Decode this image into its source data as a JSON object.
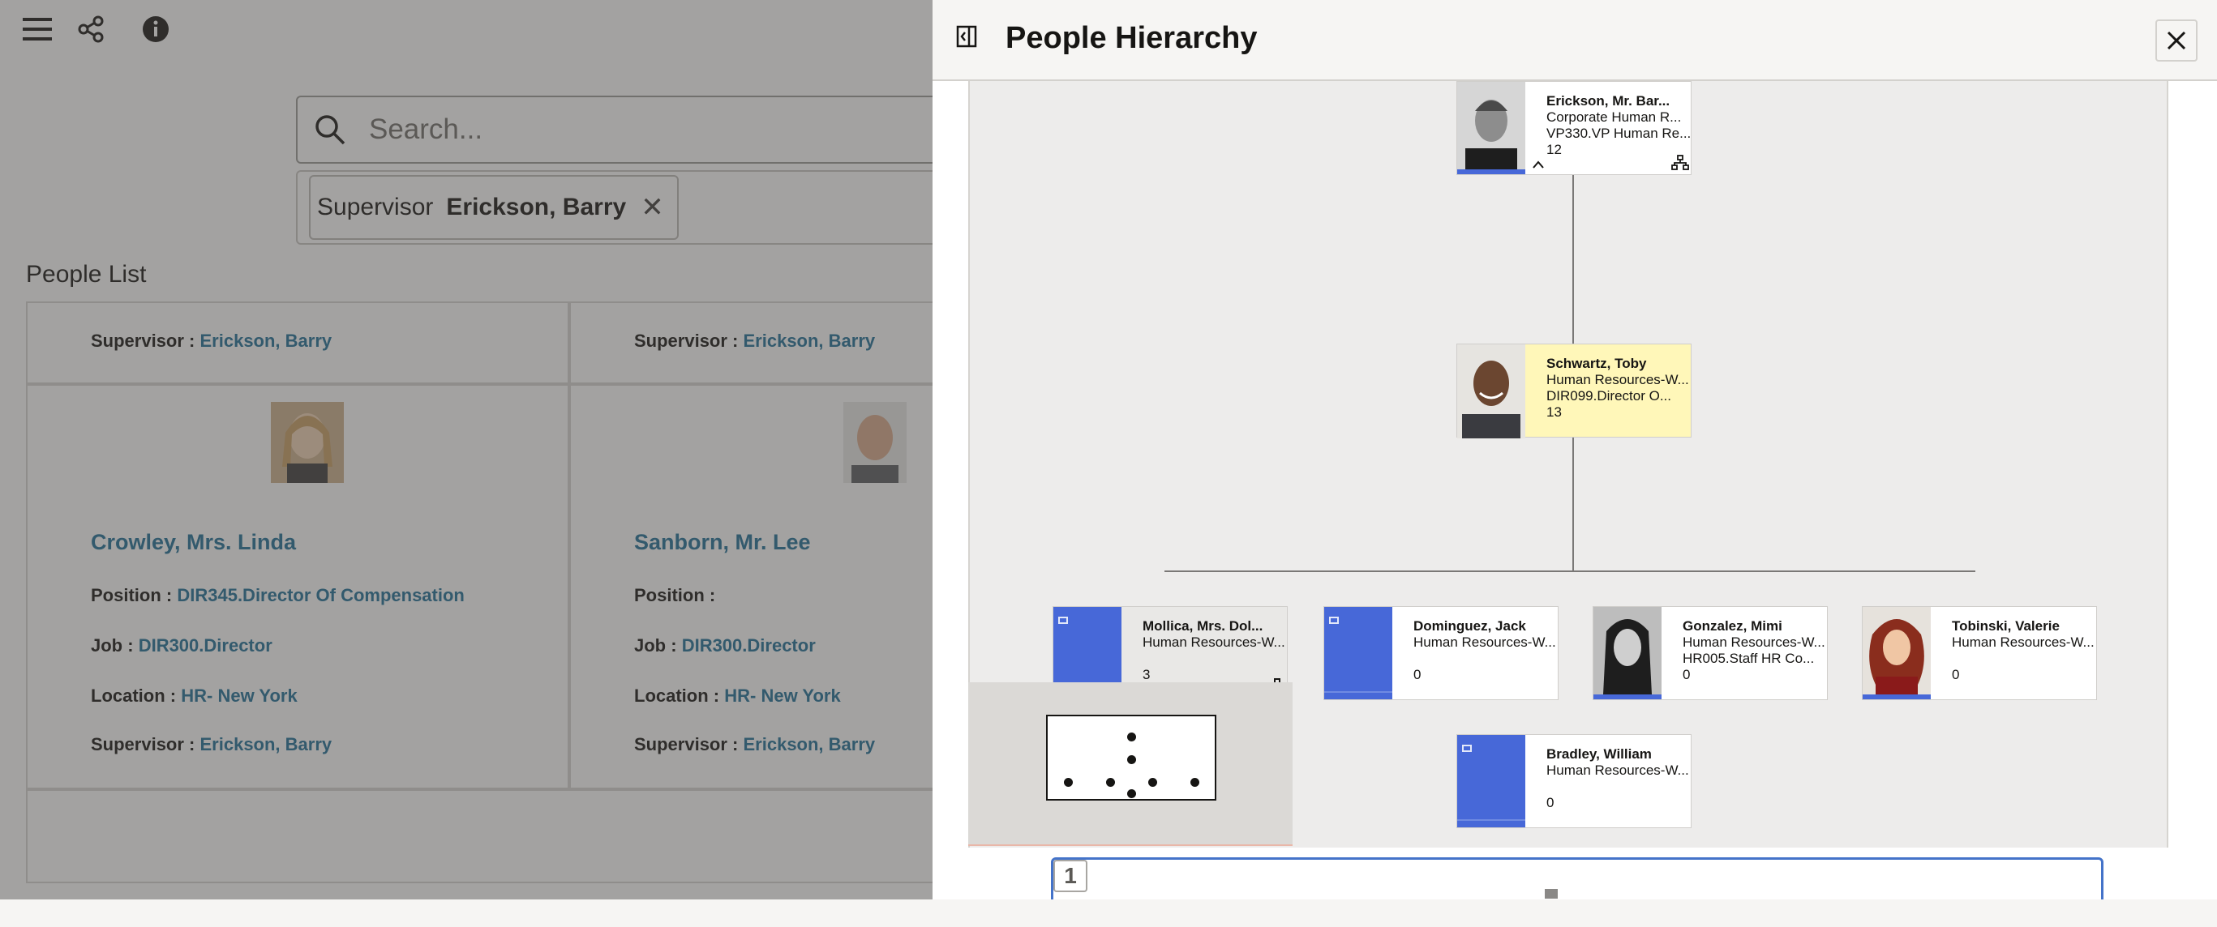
{
  "app": {
    "toolbar": {
      "menu_icon": "hamburger-icon",
      "share_icon": "share-icon",
      "info_icon": "info-icon"
    },
    "search": {
      "placeholder": "Search..."
    },
    "filter_chip": {
      "label": "Supervisor",
      "value": "Erickson, Barry"
    },
    "list_title": "People List",
    "people": [
      {
        "supervisor_label": "Supervisor :",
        "supervisor": "Erickson, Barry"
      },
      {
        "supervisor_label": "Supervisor :",
        "supervisor": "Erickson, Barry"
      },
      {
        "name": "Crowley, Mrs. Linda",
        "position_label": "Position :",
        "position": "DIR345.Director Of Compensation",
        "job_label": "Job :",
        "job": "DIR300.Director",
        "location_label": "Location :",
        "location": "HR- New York",
        "supervisor_label": "Supervisor :",
        "supervisor": "Erickson, Barry"
      },
      {
        "name": "Sanborn, Mr. Lee",
        "position_label": "Position :",
        "position": "",
        "job_label": "Job :",
        "job": "DIR300.Director",
        "location_label": "Location :",
        "location": "HR- New York",
        "supervisor_label": "Supervisor :",
        "supervisor": "Erickson, Barry"
      }
    ]
  },
  "drawer": {
    "title": "People Hierarchy",
    "nodes": {
      "root": {
        "name": "Erickson, Mr. Bar...",
        "line1": "Corporate Human R...",
        "line2": "VP330.VP Human Re...",
        "count": "12"
      },
      "selected": {
        "name": "Schwartz, Toby",
        "line1": "Human Resources-W...",
        "line2": "DIR099.Director O...",
        "count": "13"
      },
      "children": [
        {
          "name": "Mollica, Mrs. Dol...",
          "line1": "Human Resources-W...",
          "line2": "",
          "count": "3"
        },
        {
          "name": "Dominguez, Jack",
          "line1": "Human Resources-W...",
          "line2": "",
          "count": "0"
        },
        {
          "name": "Gonzalez, Mimi",
          "line1": "Human Resources-W...",
          "line2": "HR005.Staff HR Co...",
          "count": "0"
        },
        {
          "name": "Tobinski, Valerie",
          "line1": "Human Resources-W...",
          "line2": "",
          "count": "0"
        },
        {
          "name": "Bradley, William",
          "line1": "Human Resources-W...",
          "line2": "",
          "count": "0"
        }
      ]
    },
    "page_number": "1"
  },
  "colors": {
    "accent_blue": "#4768d8",
    "link": "#1f6e96",
    "selected_node": "#fff7b9"
  }
}
